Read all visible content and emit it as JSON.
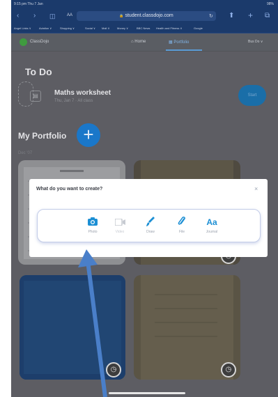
{
  "status_bar": {
    "time": "9:15 pm  Thu 7 Jan",
    "battery": "98%"
  },
  "browser": {
    "tab_label": "AA",
    "url": "student.classdojo.com",
    "bookmarks": [
      "Angel Links ∨",
      "Aviation ∨",
      "Shopping ∨",
      "Social ∨",
      "Mail ∨",
      "Money ∨",
      "BBC News",
      "Health and Fitness ∨",
      "Google"
    ]
  },
  "app": {
    "brand": "ClassDojo",
    "nav_home": "Home",
    "nav_portfolio": "Portfolio",
    "user": "Bus Do ∨"
  },
  "todo": {
    "heading": "To Do",
    "task_title": "Maths worksheet",
    "task_subtitle": "Thu, Jan 7 · All class",
    "start_label": "Start"
  },
  "portfolio": {
    "heading": "My Portfolio",
    "date_label": "Dec '07"
  },
  "modal": {
    "title": "What do you want to create?",
    "close": "×",
    "options": [
      {
        "label": "Photo",
        "icon": "camera-icon",
        "enabled": true
      },
      {
        "label": "Video",
        "icon": "video-icon",
        "enabled": false
      },
      {
        "label": "Draw",
        "icon": "brush-icon",
        "enabled": true
      },
      {
        "label": "File",
        "icon": "paperclip-icon",
        "enabled": true
      },
      {
        "label": "Journal",
        "icon": "journal-aa-icon",
        "enabled": true
      }
    ],
    "journal_glyph": "Aa"
  },
  "colors": {
    "accent": "#1c8fd4",
    "arrow": "#4a7fc9",
    "browser_bar": "#1b3a6b"
  }
}
